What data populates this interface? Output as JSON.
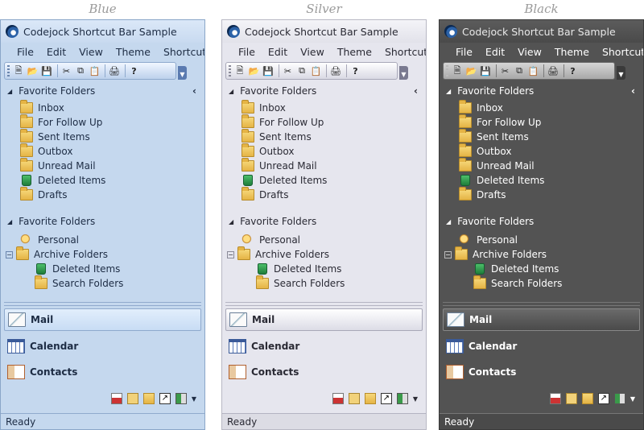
{
  "themes": [
    "Blue",
    "Silver",
    "Black"
  ],
  "window_title": "Codejock Shortcut Bar Sample",
  "menu": [
    "File",
    "Edit",
    "View",
    "Theme",
    "ShortcutBar"
  ],
  "toolbar_icons": [
    "new-icon",
    "open-icon",
    "save-icon",
    "cut-icon",
    "copy-icon",
    "paste-icon",
    "print-icon",
    "help-icon"
  ],
  "group1": {
    "header": "Favorite Folders",
    "items": [
      "Inbox",
      "For Follow Up",
      "Sent Items",
      "Outbox",
      "Unread Mail",
      "Deleted Items",
      "Drafts"
    ]
  },
  "group2": {
    "header": "Favorite Folders",
    "personal": "Personal",
    "archive": "Archive Folders",
    "archive_children": [
      "Deleted Items",
      "Search Folders"
    ]
  },
  "nav": [
    "Mail",
    "Calendar",
    "Contacts"
  ],
  "bottom_icons": [
    "tasks-icon",
    "notes-icon",
    "folder-list-icon",
    "shortcuts-icon",
    "journal-icon",
    "configure-chevron-icon"
  ],
  "status": "Ready"
}
